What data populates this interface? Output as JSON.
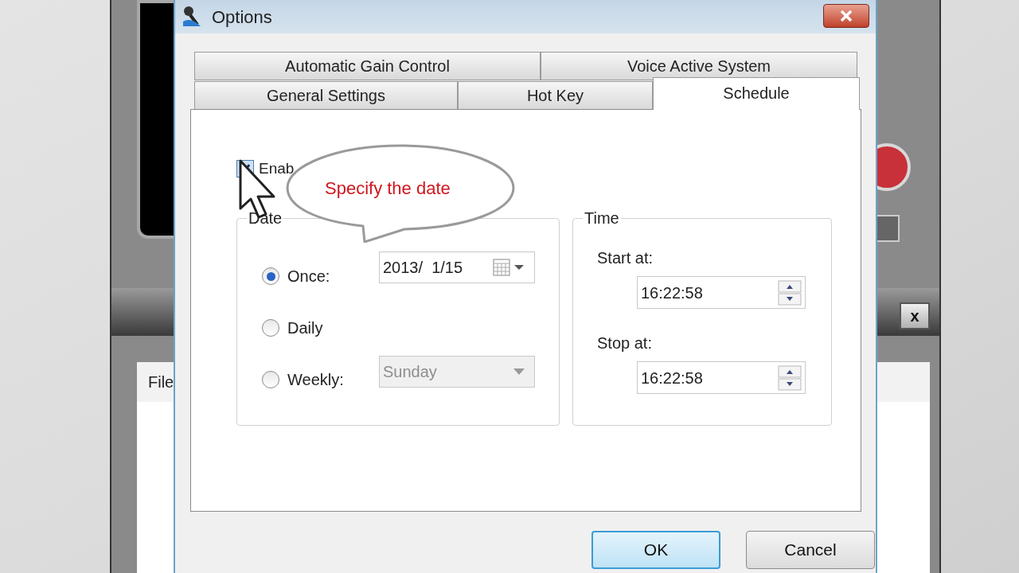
{
  "background_window": {
    "close_label": "x",
    "file_header": "File"
  },
  "window": {
    "title": "Options"
  },
  "tab_rows": [
    [
      {
        "label": "Automatic Gain Control",
        "selected": false
      },
      {
        "label": "Voice Active System",
        "selected": false
      }
    ],
    [
      {
        "label": "General Settings",
        "selected": false
      },
      {
        "label": "Hot Key",
        "selected": false
      },
      {
        "label": "Schedule",
        "selected": true
      }
    ]
  ],
  "enable_checkbox": {
    "label": "Enab",
    "checked": true
  },
  "callout": {
    "text": "Specify the date"
  },
  "date_group": {
    "title": "Date",
    "options": [
      {
        "label": "Once:",
        "selected": true,
        "control": {
          "kind": "date",
          "value": "2013/  1/15",
          "disabled": false
        }
      },
      {
        "label": "Daily",
        "selected": false
      },
      {
        "label": "Weekly:",
        "selected": false,
        "control": {
          "kind": "dropdown",
          "value": "Sunday",
          "disabled": true
        }
      }
    ]
  },
  "time_group": {
    "title": "Time",
    "fields": [
      {
        "label": "Start at:",
        "value": "16:22:58"
      },
      {
        "label": "Stop at:",
        "value": "16:22:58"
      }
    ]
  },
  "buttons": [
    {
      "label": "OK",
      "focused": true
    },
    {
      "label": "Cancel",
      "focused": false
    }
  ]
}
